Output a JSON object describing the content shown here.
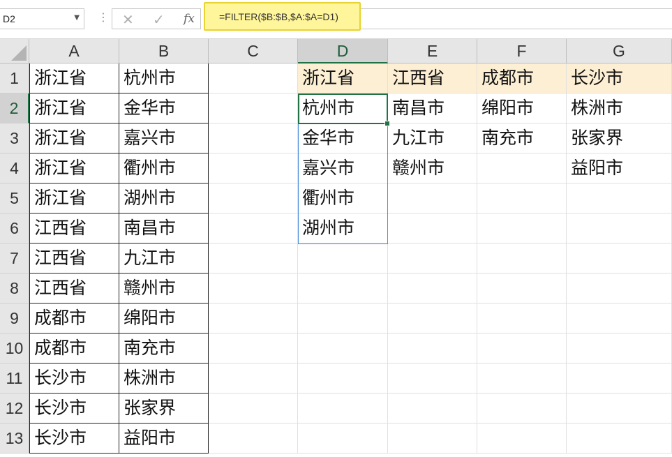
{
  "formula_bar": {
    "name_box": "D2",
    "cancel_symbol": "✕",
    "enter_symbol": "✓",
    "fx_label": "fx",
    "formula": "=FILTER($B:$B,$A:$A=D1)",
    "highlight_color": "#fff59a"
  },
  "columns": [
    "A",
    "B",
    "C",
    "D",
    "E",
    "F",
    "G"
  ],
  "rows": [
    "1",
    "2",
    "3",
    "4",
    "5",
    "6",
    "7",
    "8",
    "9",
    "10",
    "11",
    "12",
    "13"
  ],
  "selected_cell": "D2",
  "cells": {
    "A": [
      "浙江省",
      "浙江省",
      "浙江省",
      "浙江省",
      "浙江省",
      "江西省",
      "江西省",
      "江西省",
      "成都市",
      "成都市",
      "长沙市",
      "长沙市",
      "长沙市"
    ],
    "B": [
      "杭州市",
      "金华市",
      "嘉兴市",
      "衢州市",
      "湖州市",
      "南昌市",
      "九江市",
      "赣州市",
      "绵阳市",
      "南充市",
      "株洲市",
      "张家界",
      "益阳市"
    ],
    "C": [
      "",
      "",
      "",
      "",
      "",
      "",
      "",
      "",
      "",
      "",
      "",
      "",
      ""
    ],
    "D": [
      "浙江省",
      "杭州市",
      "金华市",
      "嘉兴市",
      "衢州市",
      "湖州市",
      "",
      "",
      "",
      "",
      "",
      "",
      ""
    ],
    "E": [
      "江西省",
      "南昌市",
      "九江市",
      "赣州市",
      "",
      "",
      "",
      "",
      "",
      "",
      "",
      "",
      ""
    ],
    "F": [
      "成都市",
      "绵阳市",
      "南充市",
      "",
      "",
      "",
      "",
      "",
      "",
      "",
      "",
      "",
      ""
    ],
    "G": [
      "长沙市",
      "株洲市",
      "张家界",
      "益阳市",
      "",
      "",
      "",
      "",
      "",
      "",
      "",
      "",
      ""
    ]
  },
  "header_row_highlight_color": "#fdefd4",
  "accent_color": "#217346"
}
